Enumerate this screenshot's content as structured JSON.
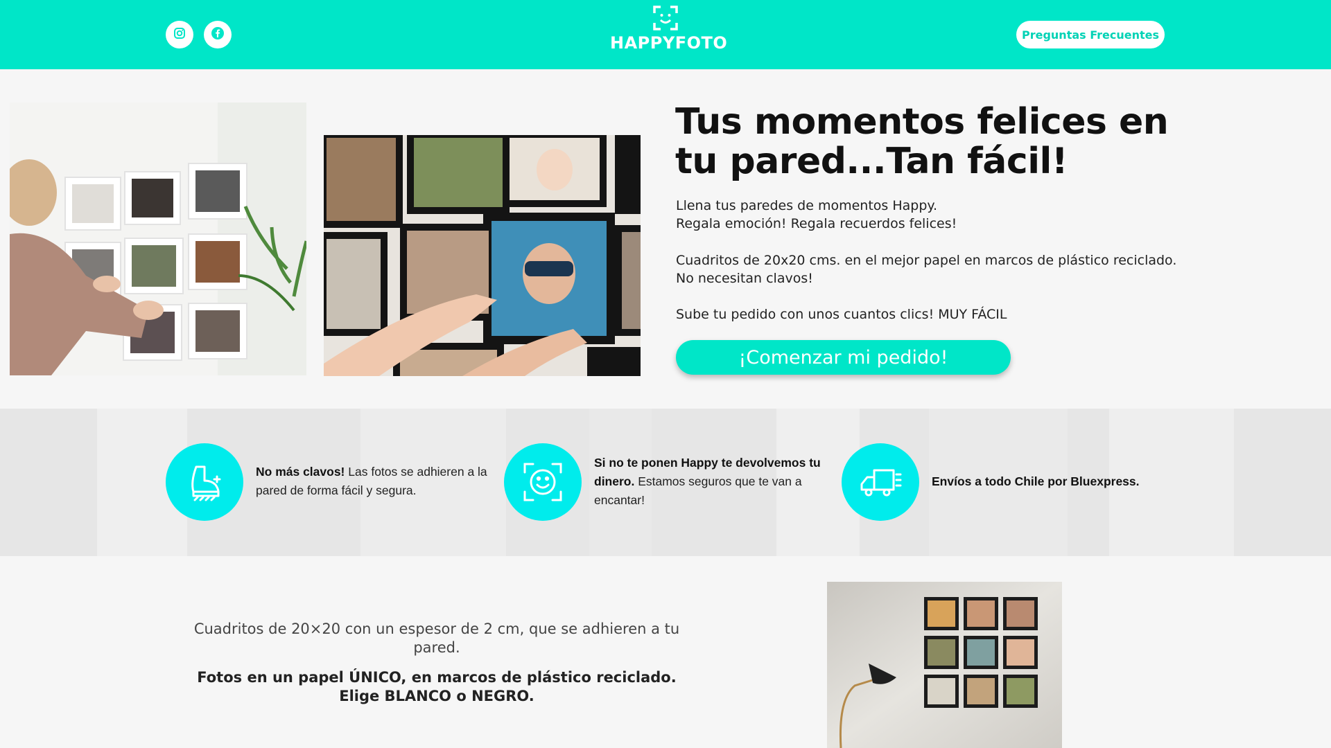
{
  "header": {
    "brand": "HAPPYFOTO",
    "faq_label": "Preguntas Frecuentes",
    "social": [
      "instagram-icon",
      "facebook-icon"
    ],
    "accent_color": "#00e6c8"
  },
  "hero": {
    "title_line1": "Tus momentos felices en",
    "title_line2": "tu pared...Tan fácil!",
    "p1_line1": "Llena tus paredes de momentos Happy.",
    "p1_line2": "Regala emoción! Regala recuerdos felices!",
    "p2_line1": "Cuadritos de 20x20 cms. en el mejor papel en marcos de plástico reciclado.",
    "p2_line2": "No necesitan clavos!",
    "p3": "Sube tu pedido con unos cuantos clics! MUY FÁCIL",
    "cta_label": "¡Comenzar mi pedido!"
  },
  "features": [
    {
      "icon": "adhesive-icon",
      "bold": "No más clavos!",
      "text": " Las fotos se adhieren a la pared de forma fácil y segura."
    },
    {
      "icon": "happy-face-icon",
      "bold": "Si no te ponen Happy te devolvemos tu dinero.",
      "text": " Estamos seguros que te van a encantar!"
    },
    {
      "icon": "delivery-truck-icon",
      "bold": "Envíos a todo Chile por Bluexpress.",
      "text": ""
    }
  ],
  "intro": {
    "line1": "Cuadritos de 20×20 con un espesor de 2 cm, que se adhieren a tu pared.",
    "line2_a": "Fotos en un papel ÚNICO, en marcos de plástico reciclado.",
    "line2_b": "Elige BLANCO o NEGRO."
  },
  "colors": {
    "accent": "#00e6c8",
    "feature_circle": "#00ecec"
  }
}
